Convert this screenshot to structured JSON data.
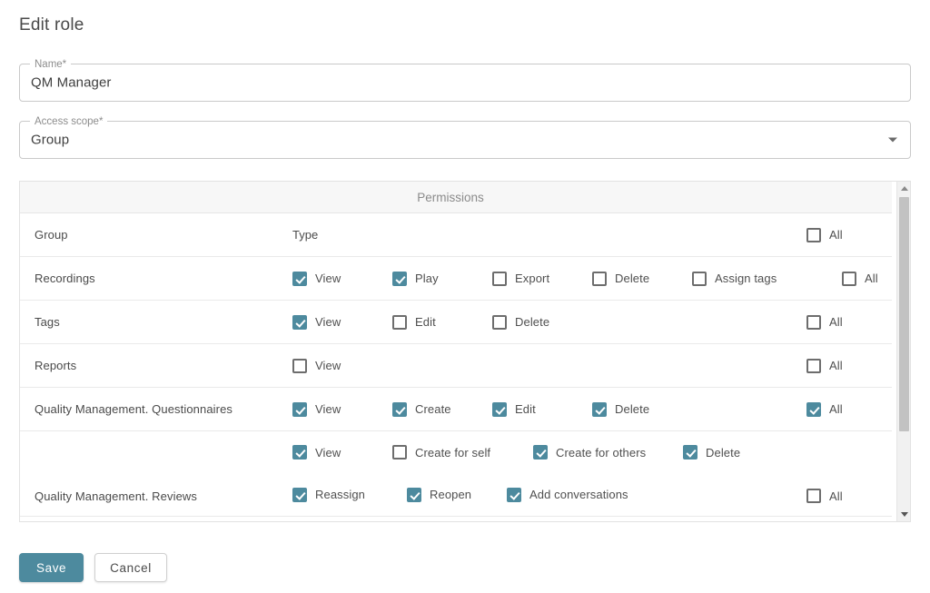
{
  "page": {
    "title": "Edit role"
  },
  "form": {
    "name": {
      "label": "Name*",
      "value": "QM Manager"
    },
    "access_scope": {
      "label": "Access scope*",
      "value": "Group",
      "icon": "chevron-down-icon"
    }
  },
  "permissions": {
    "title": "Permissions",
    "columns": {
      "group": "Group",
      "type": "Type",
      "all": "All"
    },
    "rows": [
      {
        "group": "Recordings",
        "lines": [
          [
            {
              "label": "View",
              "checked": true
            },
            {
              "label": "Play",
              "checked": true
            },
            {
              "label": "Export",
              "checked": false
            },
            {
              "label": "Delete",
              "checked": false
            },
            {
              "label": "Assign tags",
              "checked": false
            }
          ]
        ],
        "all": {
          "label": "All",
          "checked": false
        }
      },
      {
        "group": "Tags",
        "lines": [
          [
            {
              "label": "View",
              "checked": true
            },
            {
              "label": "Edit",
              "checked": false
            },
            {
              "label": "Delete",
              "checked": false
            }
          ]
        ],
        "all": {
          "label": "All",
          "checked": false
        }
      },
      {
        "group": "Reports",
        "lines": [
          [
            {
              "label": "View",
              "checked": false
            }
          ]
        ],
        "all": {
          "label": "All",
          "checked": false
        }
      },
      {
        "group": "Quality Management. Questionnaires",
        "lines": [
          [
            {
              "label": "View",
              "checked": true
            },
            {
              "label": "Create",
              "checked": true
            },
            {
              "label": "Edit",
              "checked": true
            },
            {
              "label": "Delete",
              "checked": true
            }
          ]
        ],
        "all": {
          "label": "All",
          "checked": true
        }
      },
      {
        "group": "Quality Management. Reviews",
        "lines": [
          [
            {
              "label": "View",
              "checked": true
            },
            {
              "label": "Create for self",
              "checked": false
            },
            {
              "label": "Create for others",
              "checked": true
            },
            {
              "label": "Delete",
              "checked": true
            }
          ],
          [
            {
              "label": "Reassign",
              "checked": true
            },
            {
              "label": "Reopen",
              "checked": true
            },
            {
              "label": "Add conversations",
              "checked": true
            }
          ]
        ],
        "all": {
          "label": "All",
          "checked": false
        }
      }
    ],
    "scrollbar": {
      "up_icon": "triangle-up-icon",
      "down_icon": "triangle-down-icon"
    }
  },
  "footer": {
    "save_label": "Save",
    "cancel_label": "Cancel"
  },
  "colors": {
    "accent": "#4d8a9e",
    "text": "#4a4a4a",
    "muted": "#8b8b8b",
    "border": "#e2e2e2"
  }
}
